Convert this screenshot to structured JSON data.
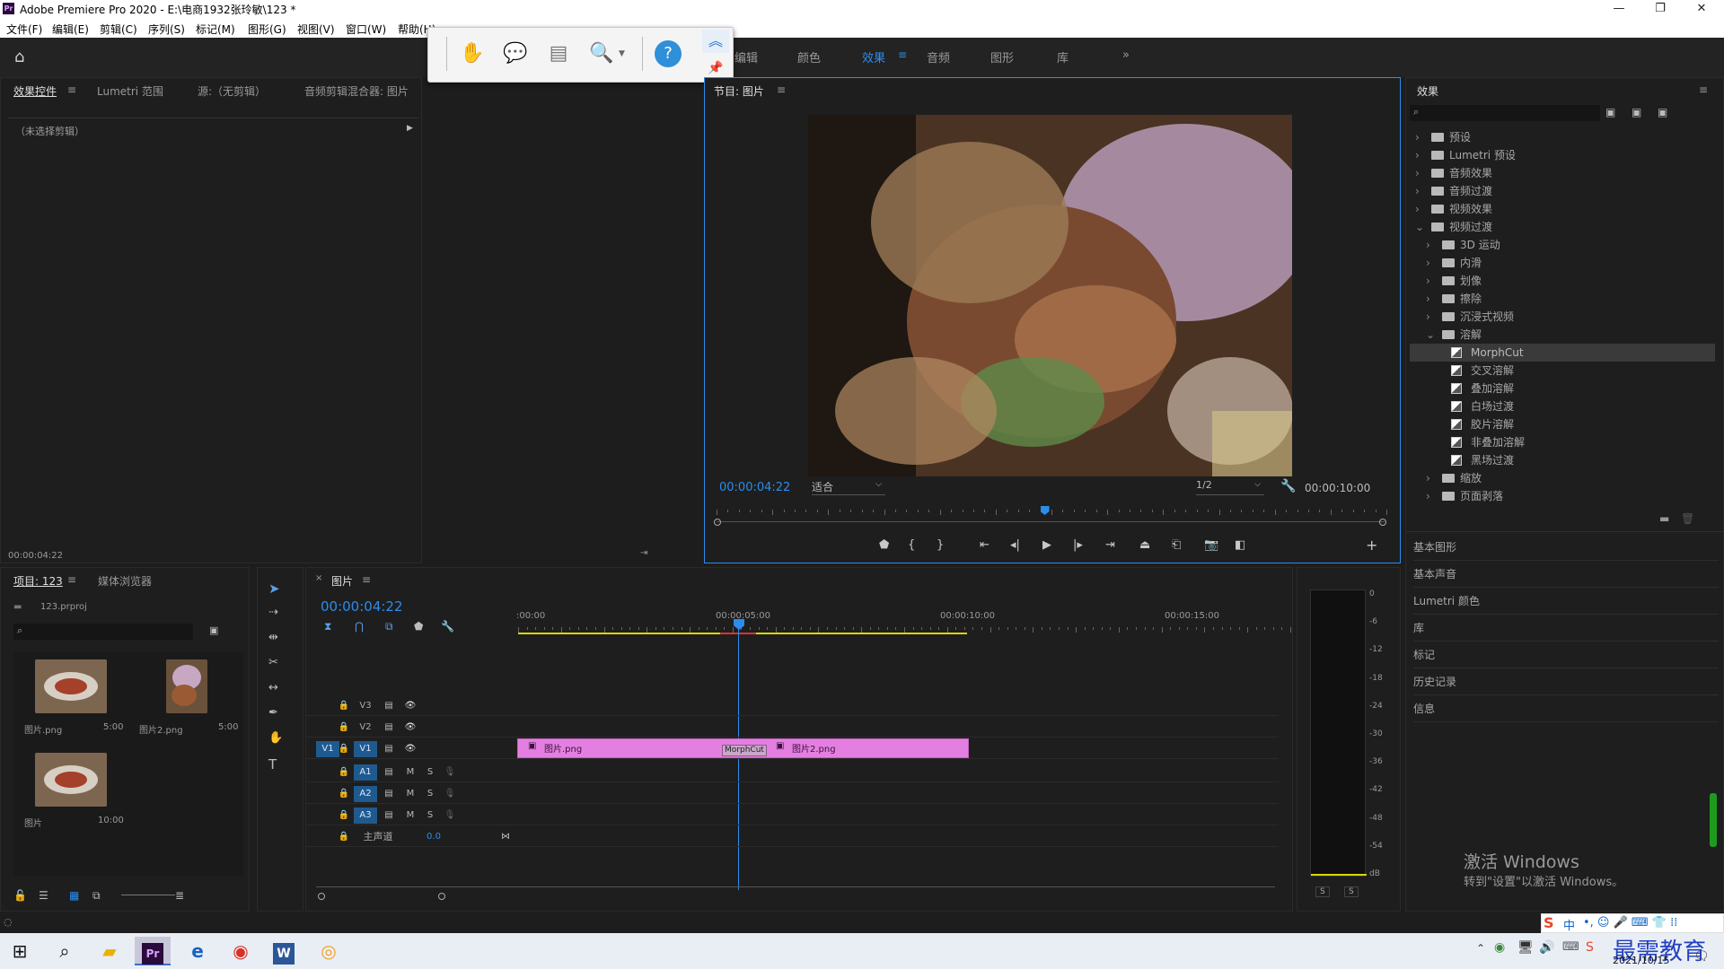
{
  "window": {
    "title": "Adobe Premiere Pro 2020 - E:\\电商1932张玲敏\\123 *",
    "app_icon": "Pr",
    "controls": [
      "—",
      "❐",
      "✕"
    ]
  },
  "menu": [
    "文件(F)",
    "编辑(E)",
    "剪辑(C)",
    "序列(S)",
    "标记(M)",
    "图形(G)",
    "视图(V)",
    "窗口(W)",
    "帮助(H)"
  ],
  "workspaces": {
    "items": [
      "编辑",
      "颜色",
      "效果",
      "音频",
      "图形",
      "库"
    ],
    "active": "效果",
    "more": "»"
  },
  "left_panel": {
    "tabs": [
      "效果控件",
      "Lumetri 范围",
      "源:（无剪辑）",
      "音频剪辑混合器: 图片"
    ],
    "no_clip": "（未选择剪辑）",
    "timecode": "00:00:04:22"
  },
  "program_monitor": {
    "tab": "节目: 图片",
    "timecode": "00:00:04:22",
    "fit": "适合",
    "quality": "1/2",
    "duration": "00:00:10:00",
    "playhead_fraction": 0.49
  },
  "effects_panel": {
    "title": "效果",
    "tree": [
      {
        "label": "预设",
        "level": 0,
        "open": false,
        "type": "folder-star"
      },
      {
        "label": "Lumetri 预设",
        "level": 0,
        "open": false,
        "type": "folder-star"
      },
      {
        "label": "音频效果",
        "level": 0,
        "open": false,
        "type": "folder"
      },
      {
        "label": "音频过渡",
        "level": 0,
        "open": false,
        "type": "folder"
      },
      {
        "label": "视频效果",
        "level": 0,
        "open": false,
        "type": "folder"
      },
      {
        "label": "视频过渡",
        "level": 0,
        "open": true,
        "type": "folder"
      },
      {
        "label": "3D 运动",
        "level": 1,
        "open": false,
        "type": "folder"
      },
      {
        "label": "内滑",
        "level": 1,
        "open": false,
        "type": "folder"
      },
      {
        "label": "划像",
        "level": 1,
        "open": false,
        "type": "folder"
      },
      {
        "label": "擦除",
        "level": 1,
        "open": false,
        "type": "folder"
      },
      {
        "label": "沉浸式视频",
        "level": 1,
        "open": false,
        "type": "folder"
      },
      {
        "label": "溶解",
        "level": 1,
        "open": true,
        "type": "folder"
      },
      {
        "label": "MorphCut",
        "level": 2,
        "type": "fx",
        "selected": true
      },
      {
        "label": "交叉溶解",
        "level": 2,
        "type": "fx"
      },
      {
        "label": "叠加溶解",
        "level": 2,
        "type": "fx"
      },
      {
        "label": "白场过渡",
        "level": 2,
        "type": "fx"
      },
      {
        "label": "胶片溶解",
        "level": 2,
        "type": "fx"
      },
      {
        "label": "非叠加溶解",
        "level": 2,
        "type": "fx"
      },
      {
        "label": "黑场过渡",
        "level": 2,
        "type": "fx"
      },
      {
        "label": "缩放",
        "level": 1,
        "open": false,
        "type": "folder"
      },
      {
        "label": "页面剥落",
        "level": 1,
        "open": false,
        "type": "folder"
      }
    ],
    "sections": [
      "基本图形",
      "基本声音",
      "Lumetri 颜色",
      "库",
      "标记",
      "历史记录",
      "信息"
    ]
  },
  "project_panel": {
    "tabs": [
      "项目: 123",
      "媒体浏览器"
    ],
    "file": "123.prproj",
    "items": [
      {
        "name": "图片.png",
        "dur": "5:00"
      },
      {
        "name": "图片2.png",
        "dur": "5:00"
      },
      {
        "name": "图片",
        "dur": "10:00"
      }
    ]
  },
  "timeline": {
    "tab": "图片",
    "timecode": "00:00:04:22",
    "ruler": [
      ":00:00",
      "00:00:05:00",
      "00:00:10:00",
      "00:00:15:00"
    ],
    "tracks": [
      {
        "name": "V3",
        "kind": "video"
      },
      {
        "name": "V2",
        "kind": "video"
      },
      {
        "name": "V1",
        "kind": "video",
        "src": "V1"
      },
      {
        "name": "A1",
        "kind": "audio"
      },
      {
        "name": "A2",
        "kind": "audio"
      },
      {
        "name": "A3",
        "kind": "audio"
      }
    ],
    "master": {
      "label": "主声道",
      "value": "0.0"
    },
    "clips": [
      {
        "name": "图片.png"
      },
      {
        "name": "图片2.png"
      }
    ],
    "transition": "MorphCut",
    "mute_label": "M",
    "solo_label": "S"
  },
  "meter": {
    "scale": [
      "0",
      "-6",
      "-12",
      "-18",
      "-24",
      "-30",
      "-36",
      "-42",
      "-48",
      "-54",
      "dB"
    ],
    "buttons": [
      "S",
      "S"
    ]
  },
  "activation": {
    "line1": "激活 Windows",
    "line2": "转到\"设置\"以激活 Windows。"
  },
  "taskbar": {
    "date": "2021/10/15",
    "ime": "中",
    "watermark": "最需教育"
  }
}
